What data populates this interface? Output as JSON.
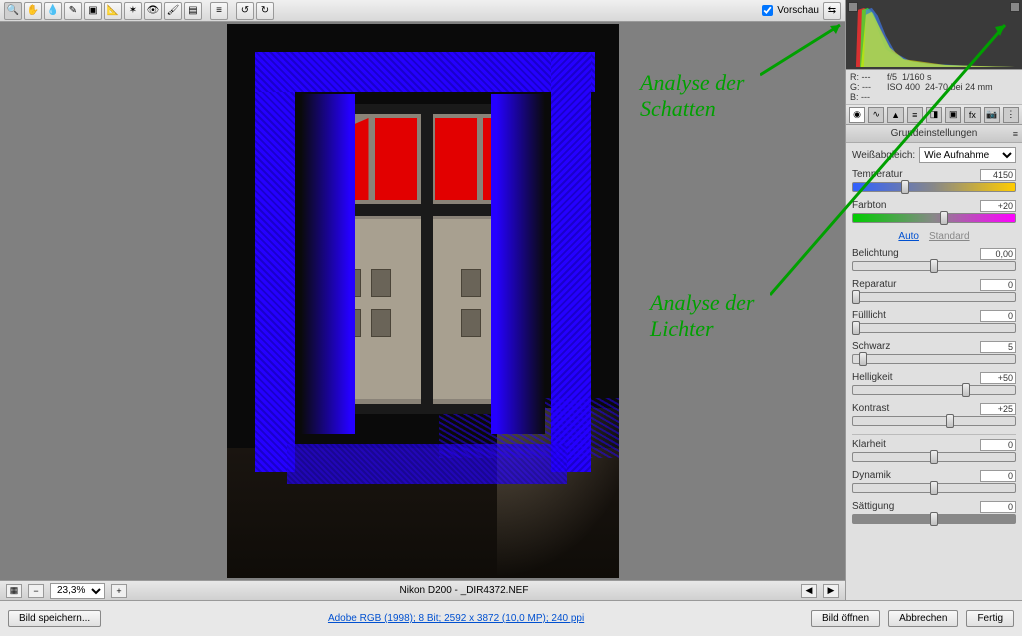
{
  "toolbar": {
    "preview_label": "Vorschau",
    "preview_checked": true
  },
  "annotations": {
    "shadows": "Analyse der\nSchatten",
    "highlights": "Analyse der\nLichter"
  },
  "info": {
    "r": "R:  ---",
    "g": "G:  ---",
    "b": "B:  ---",
    "aperture": "f/5",
    "shutter": "1/160 s",
    "iso": "ISO 400",
    "lens": "24-70 bei 24 mm"
  },
  "panel": {
    "title": "Grundeinstellungen",
    "wb_label": "Weißabgleich:",
    "wb_value": "Wie Aufnahme",
    "auto": "Auto",
    "standard": "Standard",
    "sliders": {
      "temperatur": {
        "label": "Temperatur",
        "value": "4150"
      },
      "farbton": {
        "label": "Farbton",
        "value": "+20"
      },
      "belichtung": {
        "label": "Belichtung",
        "value": "0,00"
      },
      "reparatur": {
        "label": "Reparatur",
        "value": "0"
      },
      "fuelllicht": {
        "label": "Fülllicht",
        "value": "0"
      },
      "schwarz": {
        "label": "Schwarz",
        "value": "5"
      },
      "helligkeit": {
        "label": "Helligkeit",
        "value": "+50"
      },
      "kontrast": {
        "label": "Kontrast",
        "value": "+25"
      },
      "klarheit": {
        "label": "Klarheit",
        "value": "0"
      },
      "dynamik": {
        "label": "Dynamik",
        "value": "0"
      },
      "saettigung": {
        "label": "Sättigung",
        "value": "0"
      }
    }
  },
  "bottombar": {
    "zoom": "23,3%",
    "filename": "Nikon D200 - _DIR4372.NEF"
  },
  "footer": {
    "save": "Bild speichern...",
    "profile": "Adobe RGB (1998); 8 Bit; 2592 x 3872 (10,0 MP); 240 ppi",
    "open": "Bild öffnen",
    "cancel": "Abbrechen",
    "done": "Fertig"
  }
}
